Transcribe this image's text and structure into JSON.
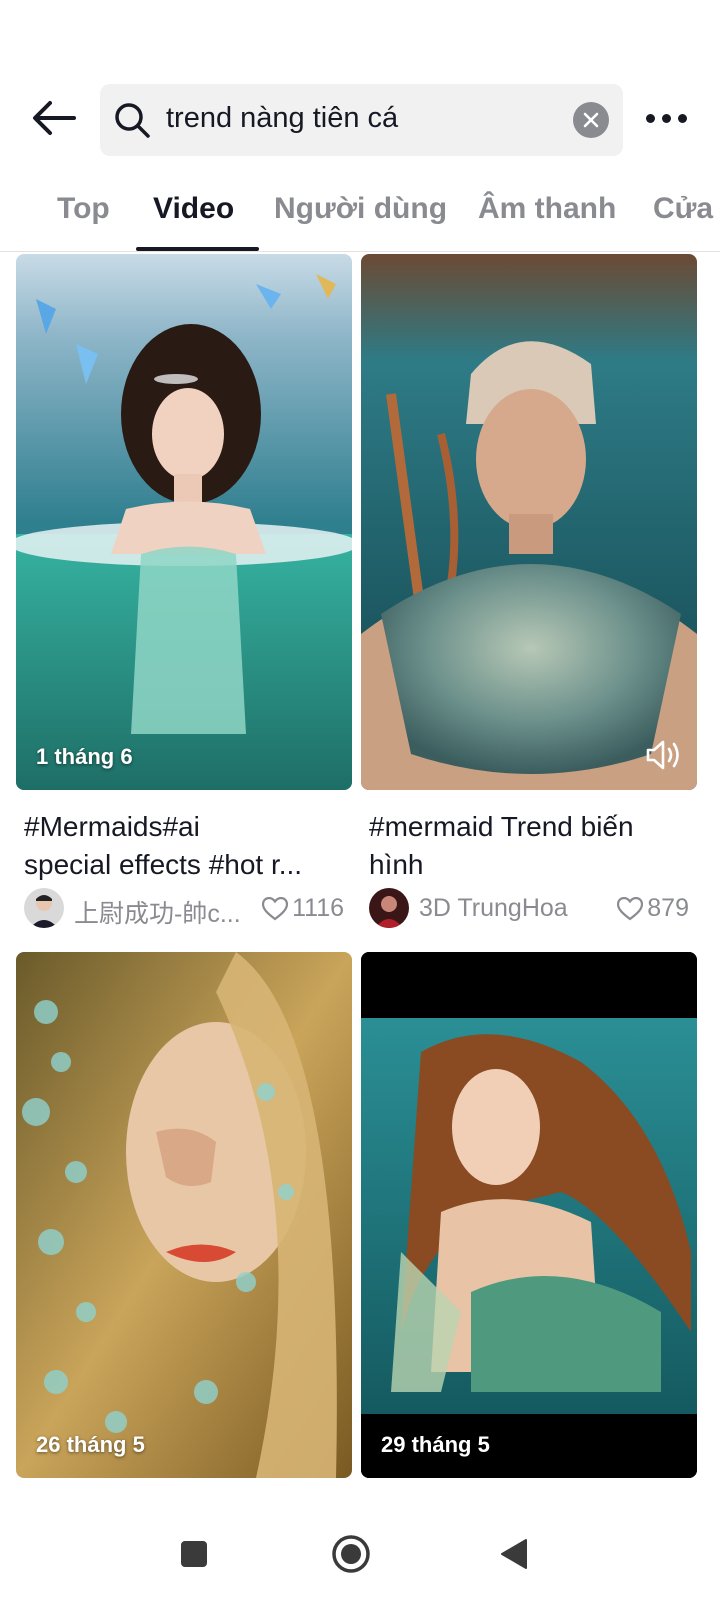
{
  "search": {
    "query": "trend nàng tiên cá"
  },
  "tabs": [
    {
      "label": "Top"
    },
    {
      "label": "Video"
    },
    {
      "label": "Người dùng"
    },
    {
      "label": "Âm thanh"
    },
    {
      "label": "Cửa"
    }
  ],
  "active_tab": "Video",
  "videos": [
    {
      "date": "1 tháng 6",
      "caption_line1": "#Mermaids#ai",
      "caption_line2": "special effects #hot r...",
      "author": "上尉成功-帥c...",
      "likes": "1116"
    },
    {
      "date": "",
      "caption_line1": "#mermaid Trend biến",
      "caption_line2": "hình",
      "author": "3D TrungHoa",
      "likes": "879"
    },
    {
      "date": "26 tháng 5"
    },
    {
      "date": "29 tháng 5"
    }
  ],
  "colors": {
    "text_primary": "#161823",
    "text_secondary": "#8a8b91",
    "search_bg": "#f1f1f2"
  },
  "icons": {
    "back": "arrow-left-icon",
    "search": "search-icon",
    "clear": "close-icon",
    "more": "more-horizontal-icon",
    "sound": "speaker-icon",
    "like": "heart-icon",
    "nav_recent": "square-icon",
    "nav_home": "circle-icon",
    "nav_back": "triangle-back-icon"
  }
}
